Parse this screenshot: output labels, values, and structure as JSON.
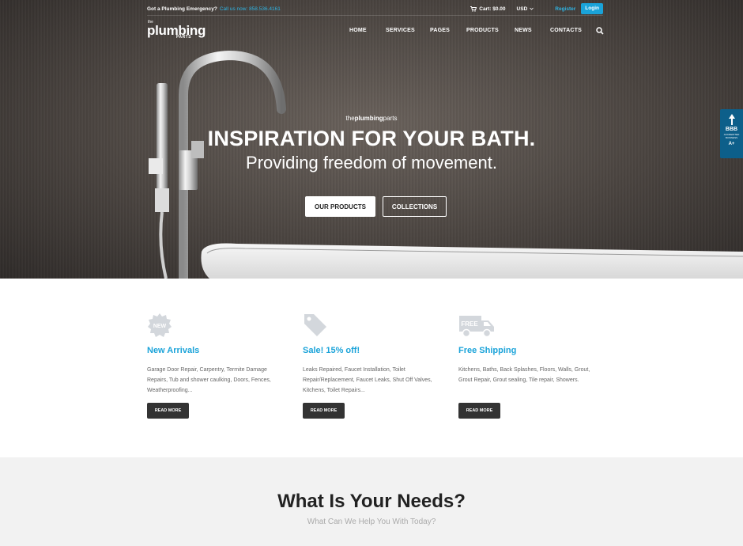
{
  "topbar": {
    "emergency": "Got a Plumbing Emergency?",
    "phone": "Call us now: 858.536.4161",
    "cart": "Cart: $0.00",
    "currency": "USD",
    "register": "Register",
    "login": "Login"
  },
  "logo": {
    "the": "the",
    "main": "plumbing",
    "parts": "PARTS"
  },
  "nav": [
    "HOME",
    "SERVICES",
    "PAGES",
    "PRODUCTS",
    "NEWS",
    "CONTACTS"
  ],
  "hero": {
    "brand_prefix": "the",
    "brand_bold": "plumbing",
    "brand_suffix": "parts",
    "headline": "INSPIRATION FOR YOUR BATH.",
    "subheadline": "Providing freedom of movement.",
    "primary_button": "OUR PRODUCTS",
    "secondary_button": "COLLECTIONS"
  },
  "bbb": {
    "label": "BBB",
    "sub": "ACCREDITED BUSINESS",
    "rating": "A+"
  },
  "features": [
    {
      "icon": "new-badge-icon",
      "badge": "NEW",
      "title": "New Arrivals",
      "desc": "Garage Door Repair, Carpentry, Termite Damage Repairs, Tub and shower caulking, Doors, Fences, Weatherproofing...",
      "button": "READ MORE"
    },
    {
      "icon": "price-tag-icon",
      "title": "Sale! 15% off!",
      "desc": "Leaks Repaired, Faucet Installation, Toilet Repair/Replacement, Faucet Leaks, Shut Off Valves, Kitchens, Toilet Repairs...",
      "button": "READ MORE"
    },
    {
      "icon": "delivery-truck-icon",
      "badge": "FREE",
      "title": "Free Shipping",
      "desc": "Kitchens, Baths, Back Splashes, Floors, Walls, Grout, Grout Repair, Grout sealing, Tile repair, Showers.",
      "button": "READ MORE"
    }
  ],
  "needs": {
    "title": "What Is Your Needs?",
    "subtitle": "What Can We Help You With Today?"
  },
  "colors": {
    "accent": "#1aa3d9",
    "dark_button": "#333333",
    "section_bg": "#f2f2f2"
  }
}
